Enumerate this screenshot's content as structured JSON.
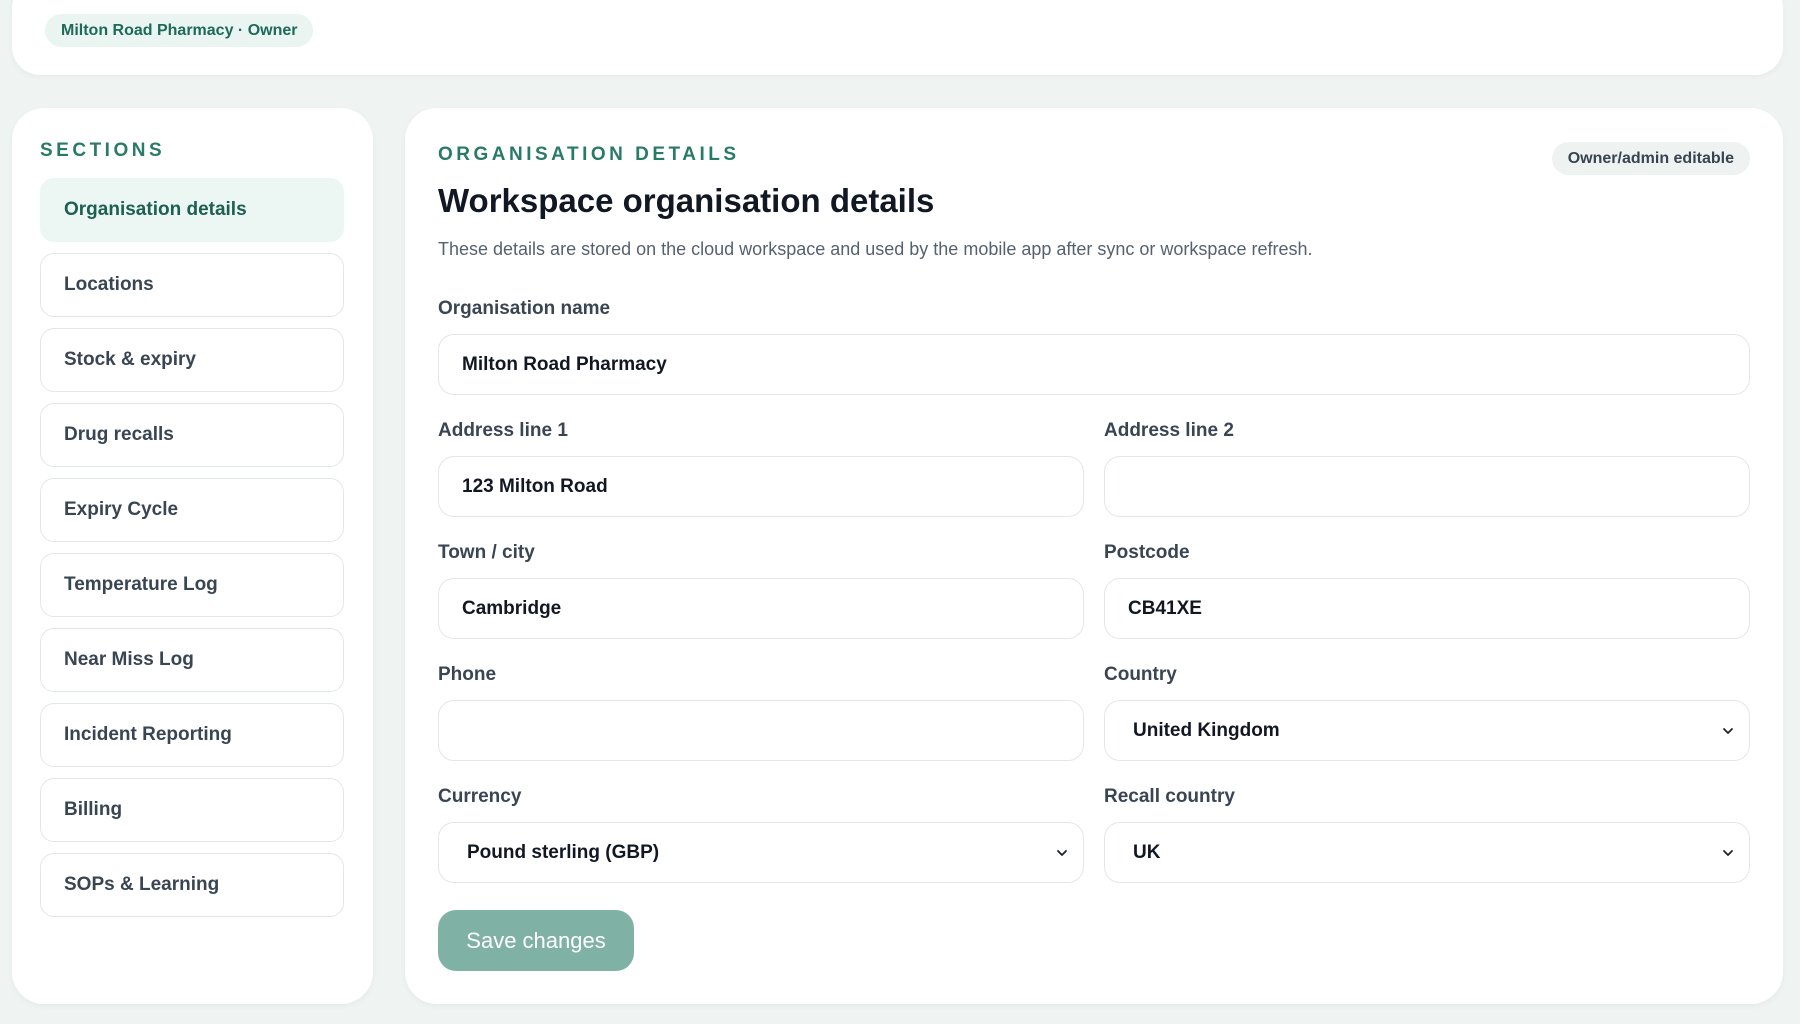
{
  "header": {
    "workspace_label": "Milton Road Pharmacy · Owner"
  },
  "sidebar": {
    "heading": "SECTIONS",
    "items": [
      {
        "label": "Organisation details",
        "active": true
      },
      {
        "label": "Locations"
      },
      {
        "label": "Stock & expiry"
      },
      {
        "label": "Drug recalls"
      },
      {
        "label": "Expiry Cycle"
      },
      {
        "label": "Temperature Log"
      },
      {
        "label": "Near Miss Log"
      },
      {
        "label": "Incident Reporting"
      },
      {
        "label": "Billing"
      },
      {
        "label": "SOPs & Learning"
      }
    ]
  },
  "main": {
    "eyebrow": "ORGANISATION DETAILS",
    "badge": "Owner/admin editable",
    "title": "Workspace organisation details",
    "description": "These details are stored on the cloud workspace and used by the mobile app after sync or workspace refresh.",
    "fields": {
      "org_name": {
        "label": "Organisation name",
        "value": "Milton Road Pharmacy"
      },
      "address1": {
        "label": "Address line 1",
        "value": "123 Milton Road"
      },
      "address2": {
        "label": "Address line 2",
        "value": ""
      },
      "town": {
        "label": "Town / city",
        "value": "Cambridge"
      },
      "postcode": {
        "label": "Postcode",
        "value": "CB41XE"
      },
      "phone": {
        "label": "Phone",
        "value": ""
      },
      "country": {
        "label": "Country",
        "value": "United Kingdom"
      },
      "currency": {
        "label": "Currency",
        "value": "Pound sterling (GBP)"
      },
      "recall_country": {
        "label": "Recall country",
        "value": "UK"
      }
    },
    "save_label": "Save changes"
  },
  "colors": {
    "accent": "#2a7a68",
    "active_nav_bg": "#ecf7f3",
    "save_button_bg": "#7fb2a5",
    "page_bg": "#eff4f2"
  },
  "icons": {
    "select_chevron": "chevron-down-icon"
  }
}
